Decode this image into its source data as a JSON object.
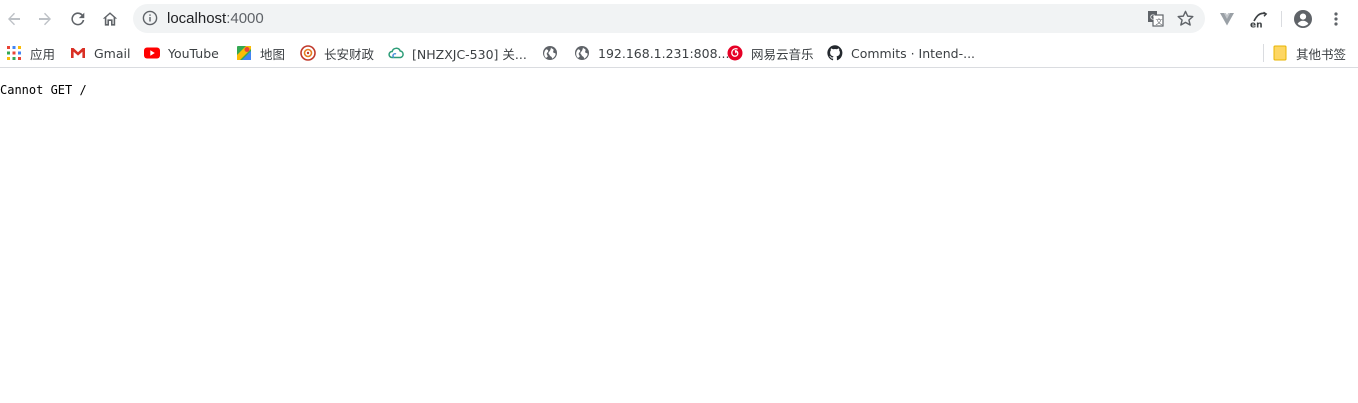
{
  "window": {
    "title": "localhost:4000"
  },
  "omnibox": {
    "host": "localhost",
    "port": ":4000",
    "icons": [
      "info-icon",
      "translate-icon",
      "star-icon"
    ]
  },
  "toolbar": {
    "icons": [
      "back-icon",
      "forward-icon",
      "reload-icon",
      "home-icon",
      "vue-devtools-icon",
      "translate-extension-icon",
      "profile-icon",
      "menu-icon"
    ],
    "extension_label": "en"
  },
  "bookmarks": {
    "items": [
      {
        "label": "应用",
        "icon": "apps-icon"
      },
      {
        "label": "Gmail",
        "icon": "gmail-icon"
      },
      {
        "label": "YouTube",
        "icon": "youtube-icon"
      },
      {
        "label": "地图",
        "icon": "maps-icon"
      },
      {
        "label": "长安财政",
        "icon": "site-icon"
      },
      {
        "label": "[NHZXJC-530] 关...",
        "icon": "cloud-icon"
      },
      {
        "label": "",
        "icon": "globe-icon"
      },
      {
        "label": "192.168.1.231:808...",
        "icon": "globe-icon"
      },
      {
        "label": "网易云音乐",
        "icon": "netease-music-icon"
      },
      {
        "label": "Commits · Intend-...",
        "icon": "github-icon"
      }
    ],
    "other": {
      "label": "其他书签",
      "icon": "folder-icon"
    }
  },
  "page": {
    "message": "Cannot GET /"
  },
  "colors": {
    "omnibox_bg": "#f1f3f4",
    "icon_gray": "#5f6368",
    "youtube_red": "#ff0000",
    "netease_red": "#e60026",
    "folder_yellow": "#fdd663"
  }
}
